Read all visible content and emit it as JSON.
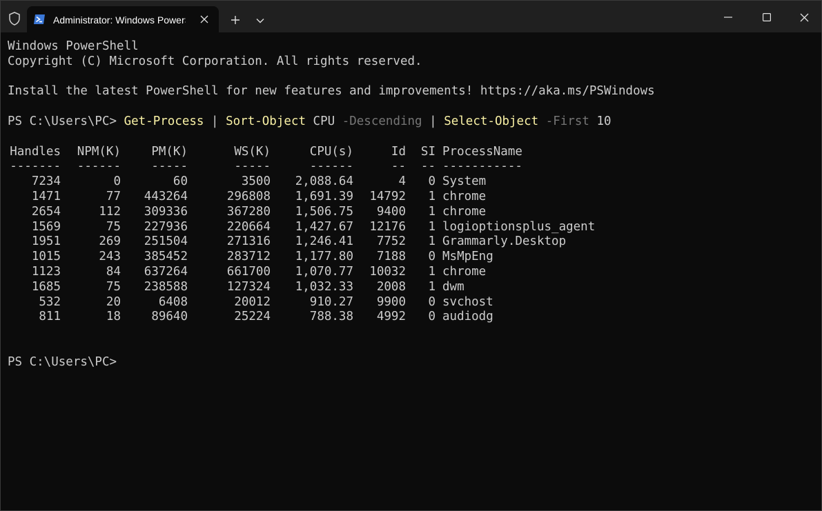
{
  "titlebar": {
    "tab_title": "Administrator: Windows PowerShell"
  },
  "console": {
    "banner": [
      "Windows PowerShell",
      "Copyright (C) Microsoft Corporation. All rights reserved.",
      "",
      "Install the latest PowerShell for new features and improvements! https://aka.ms/PSWindows"
    ],
    "prompt": "PS C:\\Users\\PC> ",
    "command": {
      "cmd1": "Get-Process",
      "pipe1": " | ",
      "cmd2": "Sort-Object",
      "arg1": " CPU ",
      "param1": "-Descending",
      "pipe2": " | ",
      "cmd3": "Select-Object",
      "param2": " -First",
      "num": " 10"
    },
    "table": {
      "headers": [
        "Handles",
        "NPM(K)",
        "PM(K)",
        "WS(K)",
        "CPU(s)",
        "Id",
        "SI",
        "ProcessName"
      ],
      "separators": [
        "-------",
        "------",
        "-----",
        "-----",
        "------",
        "--",
        "--",
        "-----------"
      ],
      "rows": [
        [
          "7234",
          "0",
          "60",
          "3500",
          "2,088.64",
          "4",
          "0",
          "System"
        ],
        [
          "1471",
          "77",
          "443264",
          "296808",
          "1,691.39",
          "14792",
          "1",
          "chrome"
        ],
        [
          "2654",
          "112",
          "309336",
          "367280",
          "1,506.75",
          "9400",
          "1",
          "chrome"
        ],
        [
          "1569",
          "75",
          "227936",
          "220664",
          "1,427.67",
          "12176",
          "1",
          "logioptionsplus_agent"
        ],
        [
          "1951",
          "269",
          "251504",
          "271316",
          "1,246.41",
          "7752",
          "1",
          "Grammarly.Desktop"
        ],
        [
          "1015",
          "243",
          "385452",
          "283712",
          "1,177.80",
          "7188",
          "0",
          "MsMpEng"
        ],
        [
          "1123",
          "84",
          "637264",
          "661700",
          "1,070.77",
          "10032",
          "1",
          "chrome"
        ],
        [
          "1685",
          "75",
          "238588",
          "127324",
          "1,032.33",
          "2008",
          "1",
          "dwm"
        ],
        [
          "532",
          "20",
          "6408",
          "20012",
          "910.27",
          "9900",
          "0",
          "svchost"
        ],
        [
          "811",
          "18",
          "89640",
          "25224",
          "788.38",
          "4992",
          "0",
          "audiodg"
        ]
      ]
    },
    "final_prompt": "PS C:\\Users\\PC>"
  },
  "colors": {
    "background": "#0c0c0c",
    "titlebar": "#202020",
    "text": "#cccccc",
    "command": "#f9f1a5",
    "parameter": "#767676"
  }
}
